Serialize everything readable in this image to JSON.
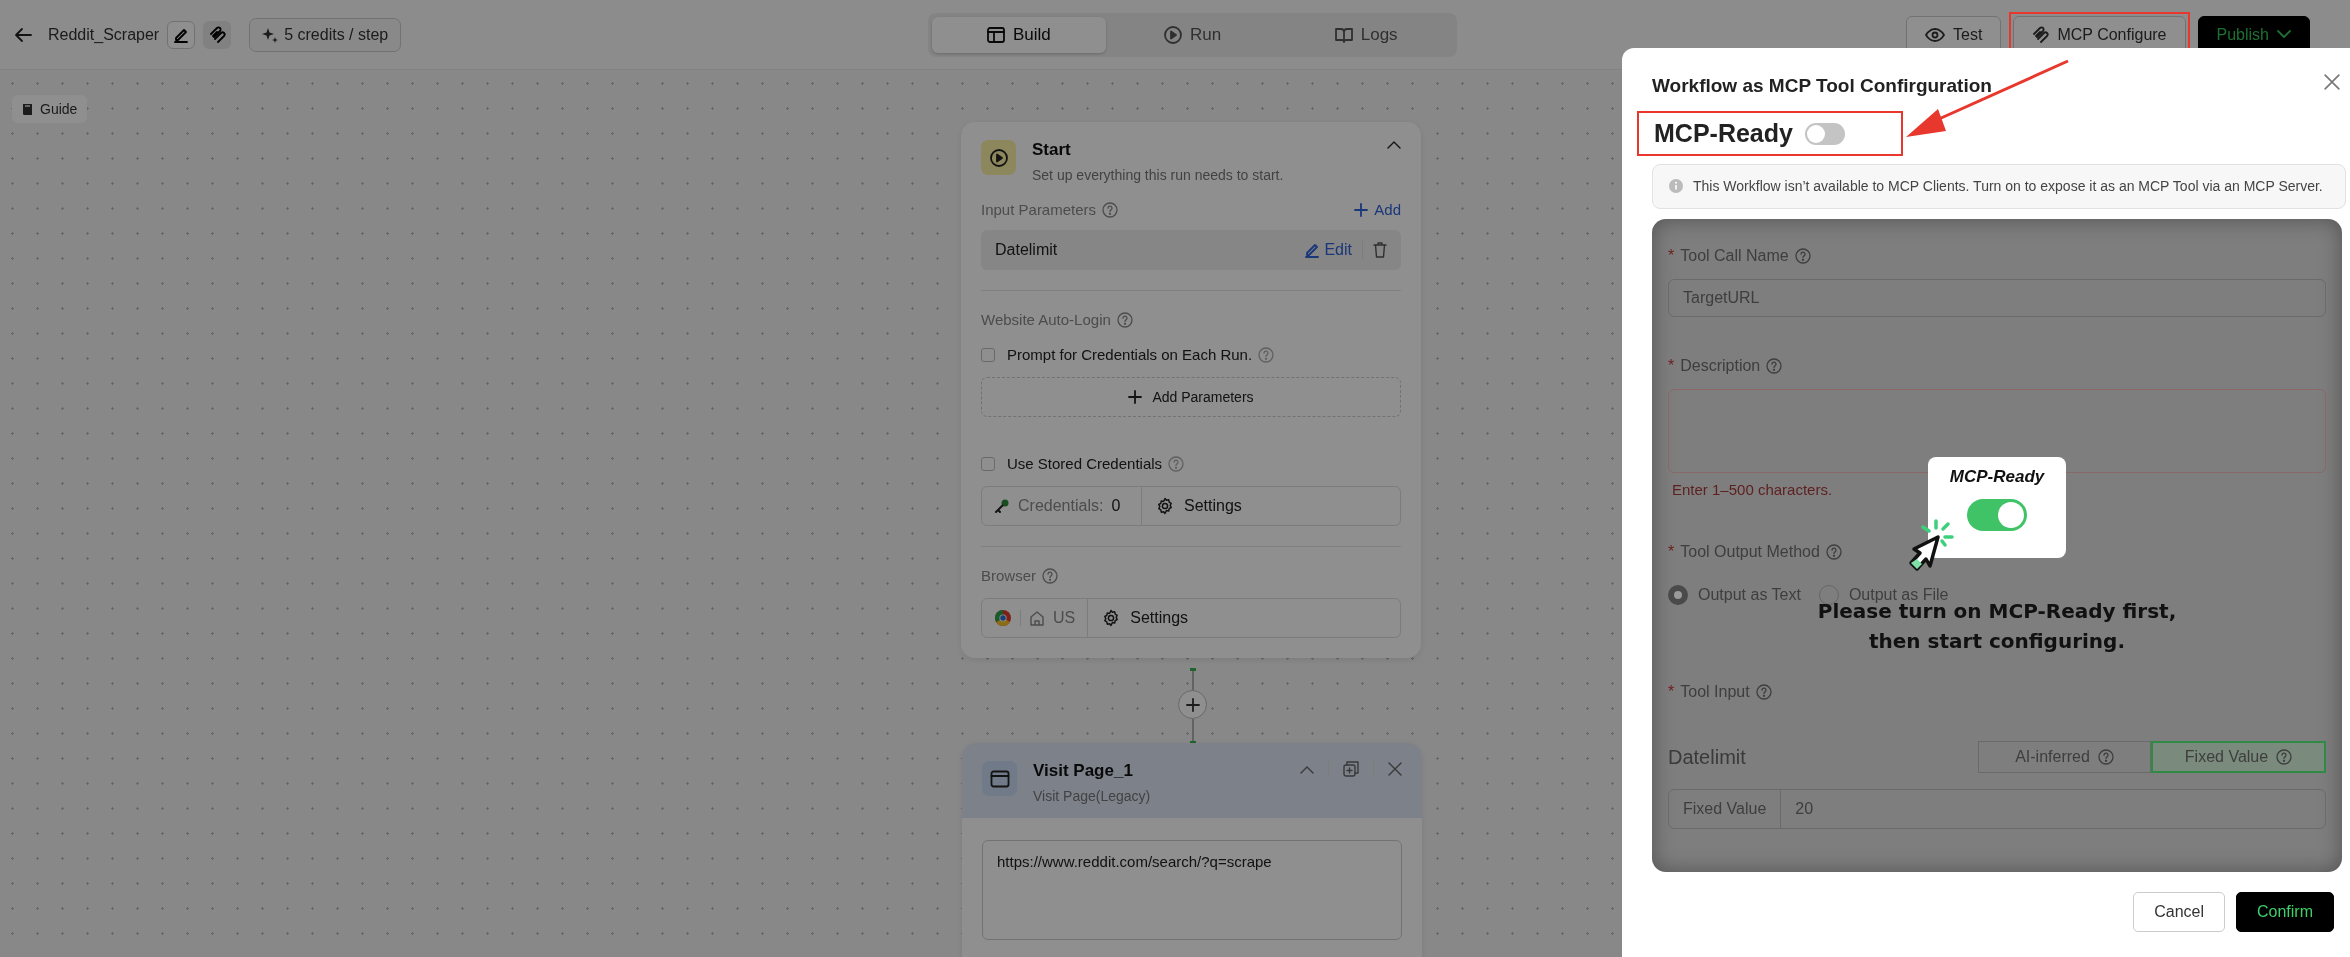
{
  "header": {
    "title": "Reddit_Scraper",
    "credits": "5 credits / step",
    "tabs": [
      {
        "label": "Build",
        "selected": true
      },
      {
        "label": "Run",
        "selected": false
      },
      {
        "label": "Logs",
        "selected": false
      }
    ],
    "actions": [
      {
        "label": "Test",
        "kind": "outline",
        "highlighted": false
      },
      {
        "label": "MCP Configure",
        "kind": "outline",
        "highlighted": true
      },
      {
        "label": "Publish",
        "kind": "primary",
        "highlighted": false
      }
    ]
  },
  "guide": "Guide",
  "start_node": {
    "title": "Start",
    "subtitle": "Set up everything this run needs to start.",
    "input_parameters": {
      "label": "Input Parameters",
      "add": "Add",
      "items": [
        {
          "name": "Datelimit",
          "edit": "Edit"
        }
      ]
    },
    "auto_login": {
      "label": "Website Auto-Login",
      "prompt": {
        "label": "Prompt for Credentials on Each Run.",
        "checked": false
      },
      "add_parameters": "Add Parameters",
      "stored": {
        "label": "Use Stored Credentials",
        "checked": false
      },
      "credentials_label": "Credentials:",
      "credentials_count": "0",
      "settings": "Settings"
    },
    "browser": {
      "label": "Browser",
      "region": "US",
      "settings": "Settings"
    }
  },
  "visit_node": {
    "title": "Visit Page_1",
    "subtitle": "Visit Page(Legacy)",
    "url": "https://www.reddit.com/search/?q=scrape"
  },
  "dialog": {
    "title": "Workflow as MCP Tool Confirguration",
    "mcp_ready": {
      "label": "MCP-Ready",
      "on": false,
      "highlighted": true
    },
    "notice": "This Workflow isn’t available to MCP Clients. Turn on to expose it as an MCP Tool via an MCP Server.",
    "form": {
      "tool_call_name": {
        "mark": "*",
        "label": "Tool Call Name",
        "value": "TargetURL"
      },
      "description": {
        "mark": "*",
        "label": "Description",
        "hint": "Enter 1–500 characters."
      },
      "output_method": {
        "mark": "*",
        "label": "Tool Output Method",
        "options": [
          {
            "label": "Output as Text",
            "selected": true
          },
          {
            "label": "Output as File",
            "selected": false
          }
        ]
      },
      "tool_input": {
        "mark": "*",
        "label": "Tool Input",
        "params": [
          {
            "name": "Datelimit",
            "modes": [
              {
                "label": "AI-inferred",
                "selected": false
              },
              {
                "label": "Fixed Value",
                "selected": true
              }
            ],
            "value_label": "Fixed Value",
            "value": "20"
          }
        ]
      }
    },
    "lock_hint": {
      "title": "MCP-Ready",
      "on": true,
      "message_lines": [
        "Please turn on MCP-Ready first,",
        "then start configuring."
      ]
    },
    "buttons": [
      {
        "label": "Cancel",
        "kind": "secondary"
      },
      {
        "label": "Confirm",
        "kind": "primary"
      }
    ]
  }
}
